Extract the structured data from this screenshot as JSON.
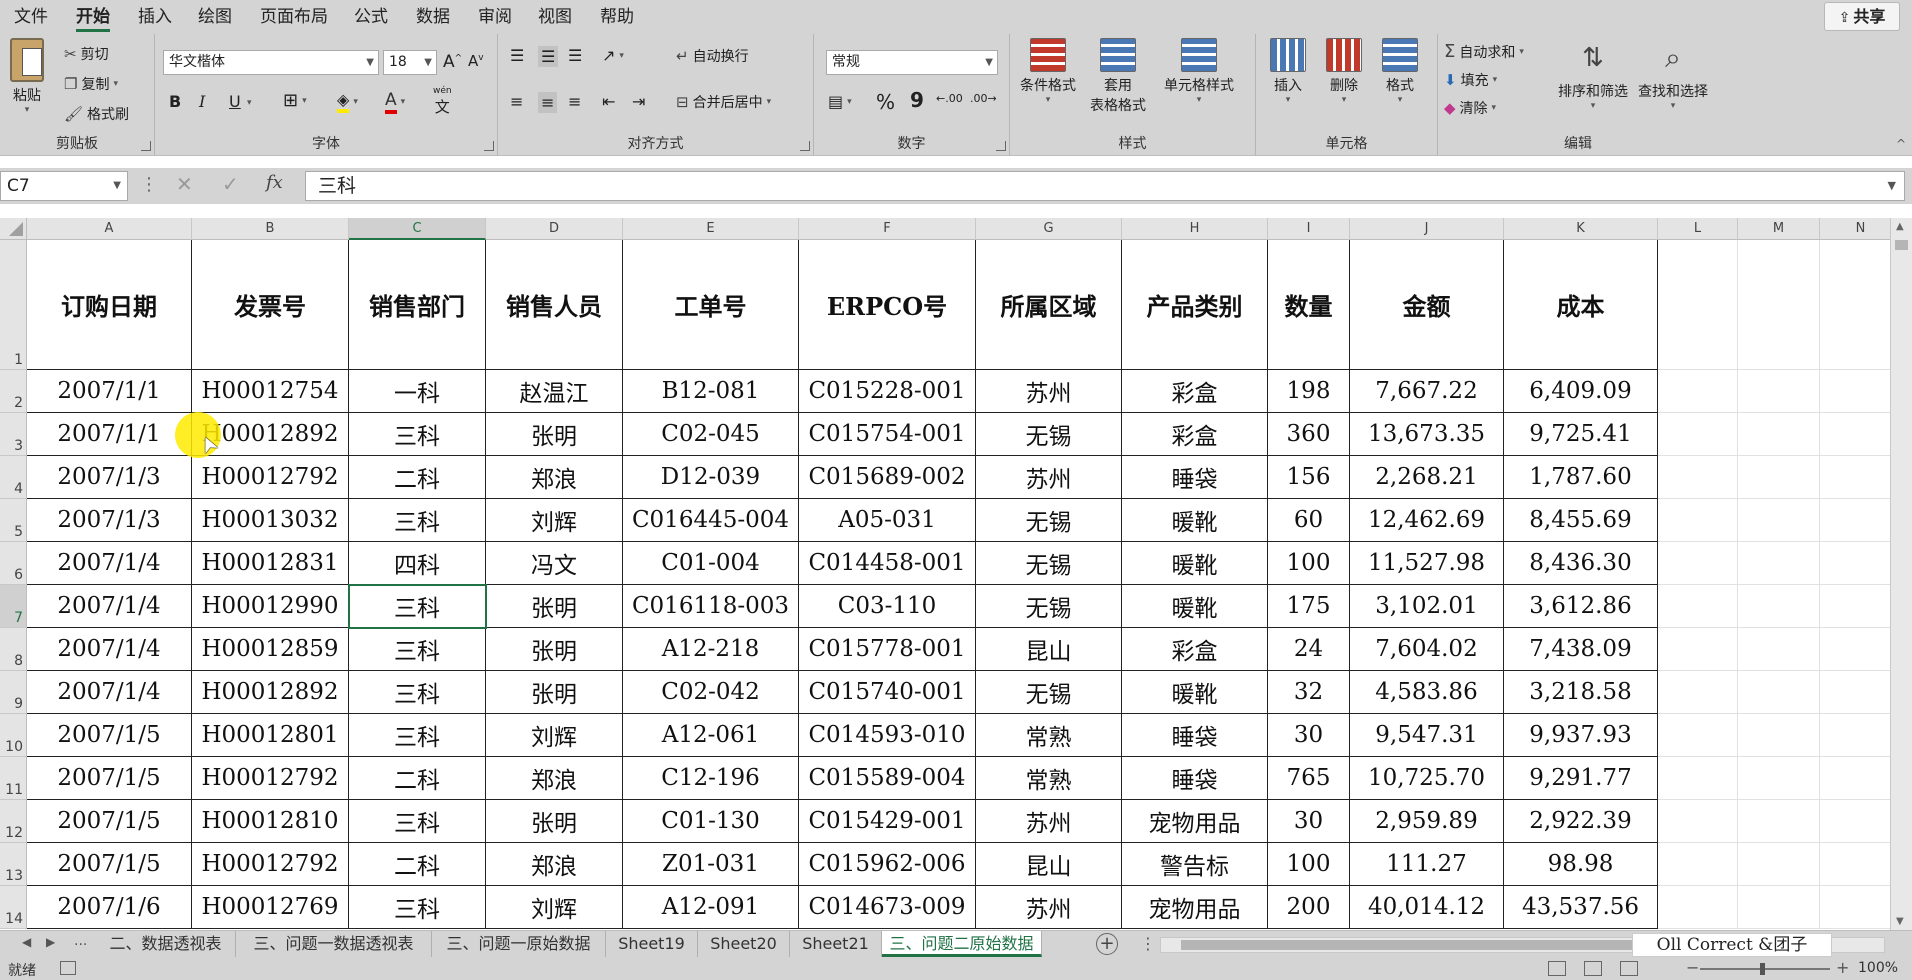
{
  "menu": {
    "tabs": [
      "文件",
      "开始",
      "插入",
      "绘图",
      "页面布局",
      "公式",
      "数据",
      "审阅",
      "视图",
      "帮助"
    ],
    "active_tab": "开始",
    "share_label": "共享"
  },
  "ribbon": {
    "clipboard": {
      "label": "剪贴板",
      "paste": "粘贴",
      "cut": "剪切",
      "copy": "复制",
      "format_painter": "格式刷"
    },
    "font": {
      "label": "字体",
      "font_name": "华文楷体",
      "font_size": "18",
      "bold": "B",
      "italic": "I",
      "underline": "U",
      "font_color_letter": "A",
      "phonetic": "wén"
    },
    "alignment": {
      "label": "对齐方式",
      "wrap_text": "自动换行",
      "merge_center": "合并后居中"
    },
    "number": {
      "label": "数字",
      "format": "常规",
      "percent": "%",
      "comma": "9"
    },
    "styles": {
      "label": "样式",
      "conditional": "条件格式",
      "table_format_1": "套用",
      "table_format_2": "表格格式",
      "cell_styles": "单元格样式"
    },
    "cells": {
      "label": "单元格",
      "insert": "插入",
      "delete": "删除",
      "format": "格式"
    },
    "editing": {
      "label": "编辑",
      "autosum": "自动求和",
      "fill": "填充",
      "clear": "清除",
      "sort_filter": "排序和筛选",
      "find_select": "查找和选择"
    }
  },
  "formula_bar": {
    "name_box": "C7",
    "fx": "fx",
    "content": "三科"
  },
  "sheet": {
    "columns": [
      "A",
      "B",
      "C",
      "D",
      "E",
      "F",
      "G",
      "H",
      "I",
      "J",
      "K",
      "L",
      "M",
      "N"
    ],
    "row_numbers": [
      "1",
      "2",
      "3",
      "4",
      "5",
      "6",
      "7",
      "8",
      "9",
      "10",
      "11",
      "12",
      "13",
      "14"
    ],
    "headers": [
      "订购日期",
      "发票号",
      "销售部门",
      "销售人员",
      "工单号",
      "ERPCO号",
      "所属区域",
      "产品类别",
      "数量",
      "金额",
      "成本"
    ],
    "rows": [
      [
        "2007/1/1",
        "H00012754",
        "一科",
        "赵温江",
        "B12-081",
        "C015228-001",
        "苏州",
        "彩盒",
        "198",
        "7,667.22",
        "6,409.09"
      ],
      [
        "2007/1/1",
        "H00012892",
        "三科",
        "张明",
        "C02-045",
        "C015754-001",
        "无锡",
        "彩盒",
        "360",
        "13,673.35",
        "9,725.41"
      ],
      [
        "2007/1/3",
        "H00012792",
        "二科",
        "郑浪",
        "D12-039",
        "C015689-002",
        "苏州",
        "睡袋",
        "156",
        "2,268.21",
        "1,787.60"
      ],
      [
        "2007/1/3",
        "H00013032",
        "三科",
        "刘辉",
        "C016445-004",
        "A05-031",
        "无锡",
        "暖靴",
        "60",
        "12,462.69",
        "8,455.69"
      ],
      [
        "2007/1/4",
        "H00012831",
        "四科",
        "冯文",
        "C01-004",
        "C014458-001",
        "无锡",
        "暖靴",
        "100",
        "11,527.98",
        "8,436.30"
      ],
      [
        "2007/1/4",
        "H00012990",
        "三科",
        "张明",
        "C016118-003",
        "C03-110",
        "无锡",
        "暖靴",
        "175",
        "3,102.01",
        "3,612.86"
      ],
      [
        "2007/1/4",
        "H00012859",
        "三科",
        "张明",
        "A12-218",
        "C015778-001",
        "昆山",
        "彩盒",
        "24",
        "7,604.02",
        "7,438.09"
      ],
      [
        "2007/1/4",
        "H00012892",
        "三科",
        "张明",
        "C02-042",
        "C015740-001",
        "无锡",
        "暖靴",
        "32",
        "4,583.86",
        "3,218.58"
      ],
      [
        "2007/1/5",
        "H00012801",
        "三科",
        "刘辉",
        "A12-061",
        "C014593-010",
        "常熟",
        "睡袋",
        "30",
        "9,547.31",
        "9,937.93"
      ],
      [
        "2007/1/5",
        "H00012792",
        "二科",
        "郑浪",
        "C12-196",
        "C015589-004",
        "常熟",
        "睡袋",
        "765",
        "10,725.70",
        "9,291.77"
      ],
      [
        "2007/1/5",
        "H00012810",
        "三科",
        "张明",
        "C01-130",
        "C015429-001",
        "苏州",
        "宠物用品",
        "30",
        "2,959.89",
        "2,922.39"
      ],
      [
        "2007/1/5",
        "H00012792",
        "二科",
        "郑浪",
        "Z01-031",
        "C015962-006",
        "昆山",
        "警告标",
        "100",
        "111.27",
        "98.98"
      ],
      [
        "2007/1/6",
        "H00012769",
        "三科",
        "刘辉",
        "A12-091",
        "C014673-009",
        "苏州",
        "宠物用品",
        "200",
        "40,014.12",
        "43,537.56"
      ]
    ]
  },
  "sheet_tabs": {
    "ellipsis": "...",
    "tabs": [
      "二、数据透视表",
      "三、问题一数据透视表",
      "三、问题一原始数据",
      "Sheet19",
      "Sheet20",
      "Sheet21",
      "三、问题二原始数据"
    ],
    "active": "三、问题二原始数据",
    "add": "+",
    "more": "⋮"
  },
  "watermark": "Oll Correct &团子",
  "status": {
    "ready": "就绪",
    "zoom": "100%"
  },
  "colors": {
    "accent": "#217346",
    "cursor_highlight": "#ffeb00"
  }
}
